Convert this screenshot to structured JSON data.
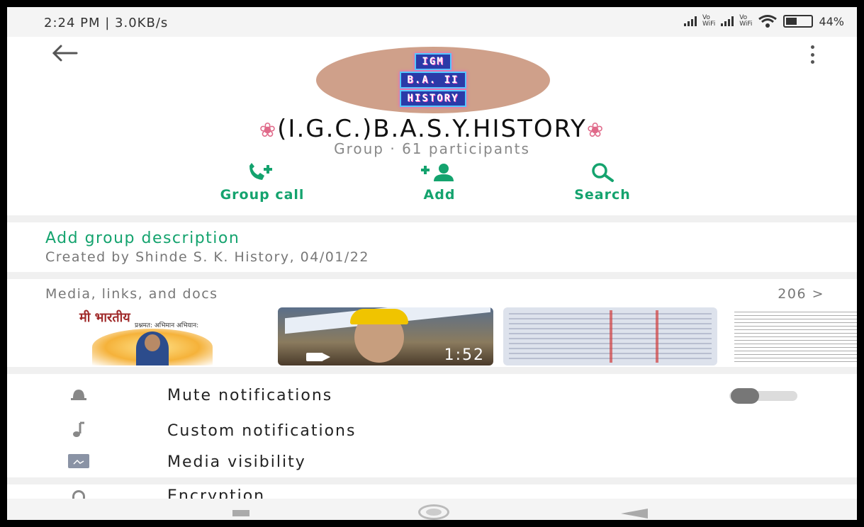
{
  "status_bar": {
    "time_speed": "2:24 PM | 3.0KB/s",
    "vo_wifi": "Vo\nWiFi",
    "battery": "44%",
    "battery_level": 0.44
  },
  "header": {
    "avatar_lines": [
      "IGM",
      "B.A. II",
      "HISTORY"
    ],
    "group_name": "(I.G.C.)B.A.S.Y.HISTORY",
    "subtitle": "Group · 61 participants"
  },
  "actions": [
    {
      "label": "Group call",
      "icon": "group-call-icon"
    },
    {
      "label": "Add",
      "icon": "add-participant-icon"
    },
    {
      "label": "Search",
      "icon": "search-icon"
    }
  ],
  "description": {
    "add_label": "Add group description",
    "created": "Created by Shinde S. K. History, 04/01/22"
  },
  "media": {
    "title": "Media, links, and docs",
    "count": "206 >",
    "thumb1": {
      "title": "मी भारतीय",
      "subtitle": "प्रश्नमत: अभिमान अभियान:"
    },
    "thumb2": {
      "duration": "1:52"
    }
  },
  "settings": [
    {
      "label": "Mute notifications",
      "icon": "bell-icon",
      "toggle": false
    },
    {
      "label": "Custom notifications",
      "icon": "music-note-icon"
    },
    {
      "label": "Media visibility",
      "icon": "image-icon"
    }
  ],
  "encryption": {
    "label": "Encryption",
    "icon": "lock-icon"
  },
  "colors": {
    "accent": "#14a36e",
    "avatar_bg": "#cfa08a"
  }
}
